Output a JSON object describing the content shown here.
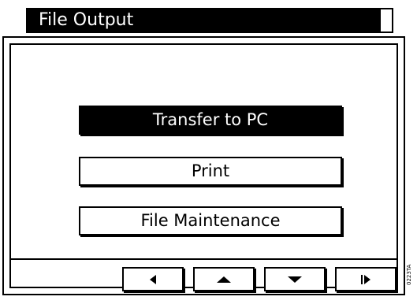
{
  "window": {
    "title": "File Output"
  },
  "menu": {
    "items": [
      {
        "label": "Transfer to PC",
        "selected": true
      },
      {
        "label": "Print",
        "selected": false
      },
      {
        "label": "File Maintenance",
        "selected": false
      }
    ]
  },
  "nav": {
    "icons": [
      "arrow-left-icon",
      "arrow-up-icon",
      "arrow-down-icon",
      "arrow-right-bar-icon"
    ]
  },
  "figure": {
    "id": "0223TA"
  },
  "colors": {
    "foreground": "#000000",
    "background": "#ffffff"
  }
}
